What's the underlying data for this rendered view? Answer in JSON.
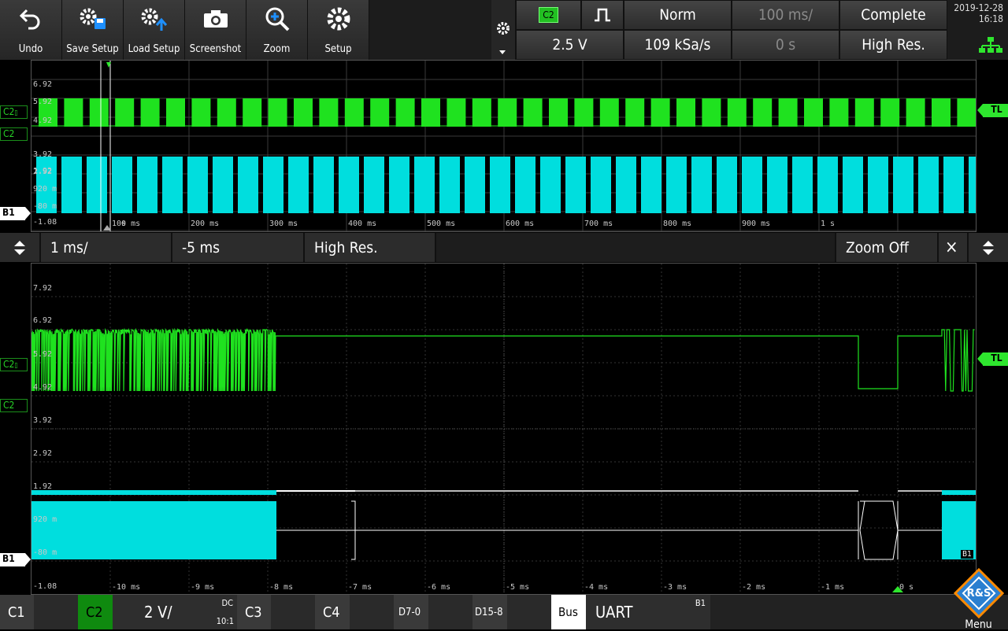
{
  "toolbar": {
    "undo": "Undo",
    "save_setup": "Save Setup",
    "load_setup": "Load Setup",
    "screenshot": "Screenshot",
    "zoom": "Zoom",
    "setup": "Setup"
  },
  "trigger": {
    "source": "C2",
    "level": "2.5 V",
    "mode": "Norm",
    "sample_rate": "109 kSa/s",
    "timebase": "100 ms/",
    "position": "0 s",
    "acquisition": "Complete",
    "resolution": "High Res."
  },
  "datetime": {
    "date": "2019-12-28",
    "time": "16:18"
  },
  "overview": {
    "y_labels": [
      "6.92",
      "5.92",
      "4.92",
      "3.92",
      "2.92",
      "1.92",
      "920 m",
      "-80 m",
      "-1.08"
    ],
    "x_labels": [
      "s",
      "100 ms",
      "200 ms",
      "300 ms",
      "400 ms",
      "500 ms",
      "600 ms",
      "700 ms",
      "800 ms",
      "900 ms",
      "1 s"
    ]
  },
  "zoom_bar": {
    "timebase": "1 ms/",
    "position": "-5 ms",
    "resolution": "High Res.",
    "zoom_off": "Zoom Off",
    "close": "×"
  },
  "zoom_window": {
    "y_labels": [
      "7.92",
      "6.92",
      "5.92",
      "4.92",
      "3.92",
      "2.92",
      "1.92",
      "920 m",
      "-80 m",
      "-1.08"
    ],
    "x_labels": [
      "-10 ms",
      "-9 ms",
      "-8 ms",
      "-7 ms",
      "-6 ms",
      "-5 ms",
      "-4 ms",
      "-3 ms",
      "-2 ms",
      "-1 ms",
      "0 s"
    ]
  },
  "tags": {
    "c2": "C2",
    "b1": "B1",
    "tl": "TL"
  },
  "bottom": {
    "c1": "C1",
    "c2": "C2",
    "c2_scale": "2 V/",
    "c2_coupling": "DC",
    "c2_probe": "10:1",
    "c3": "C3",
    "c4": "C4",
    "d7": "D7-0",
    "d15": "D15-8",
    "bus": "Bus",
    "bus_protocol": "UART",
    "bus_tag": "B1",
    "menu": "Menu"
  },
  "colors": {
    "c2": "#1fe21f",
    "bus": "#00dede",
    "accent": "#ff8a00"
  }
}
